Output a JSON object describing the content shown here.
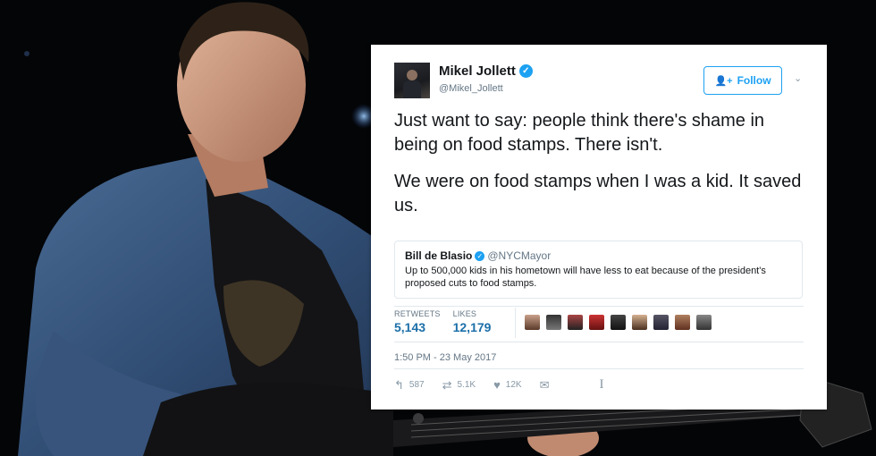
{
  "tweet": {
    "author_name": "Mikel Jollett",
    "author_handle": "@Mikel_Jollett",
    "follow_label": "Follow",
    "paragraphs": [
      "Just want to say: people think there's shame in being on food stamps. There isn't.",
      "We were on food stamps when I was a kid. It saved us."
    ],
    "quoted": {
      "name": "Bill de Blasio",
      "handle": "@NYCMayor",
      "text": "Up to 500,000 kids in his hometown will have less to eat because of the president's proposed cuts to food stamps."
    },
    "stats": {
      "retweets_label": "RETWEETS",
      "retweets_value": "5,143",
      "likes_label": "LIKES",
      "likes_value": "12,179"
    },
    "timestamp": "1:50 PM - 23 May 2017",
    "actions": {
      "reply_count": "587",
      "retweet_count": "5.1K",
      "like_count": "12K"
    }
  },
  "colors": {
    "accent": "#1da1f2",
    "stat_value": "#1b6fa8",
    "muted": "#657786"
  },
  "icons": {
    "verified": "verified-badge-icon",
    "follow": "person-add-icon",
    "more": "chevron-down-icon",
    "reply": "reply-icon",
    "retweet": "retweet-icon",
    "like": "heart-icon",
    "dm": "direct-message-icon"
  }
}
